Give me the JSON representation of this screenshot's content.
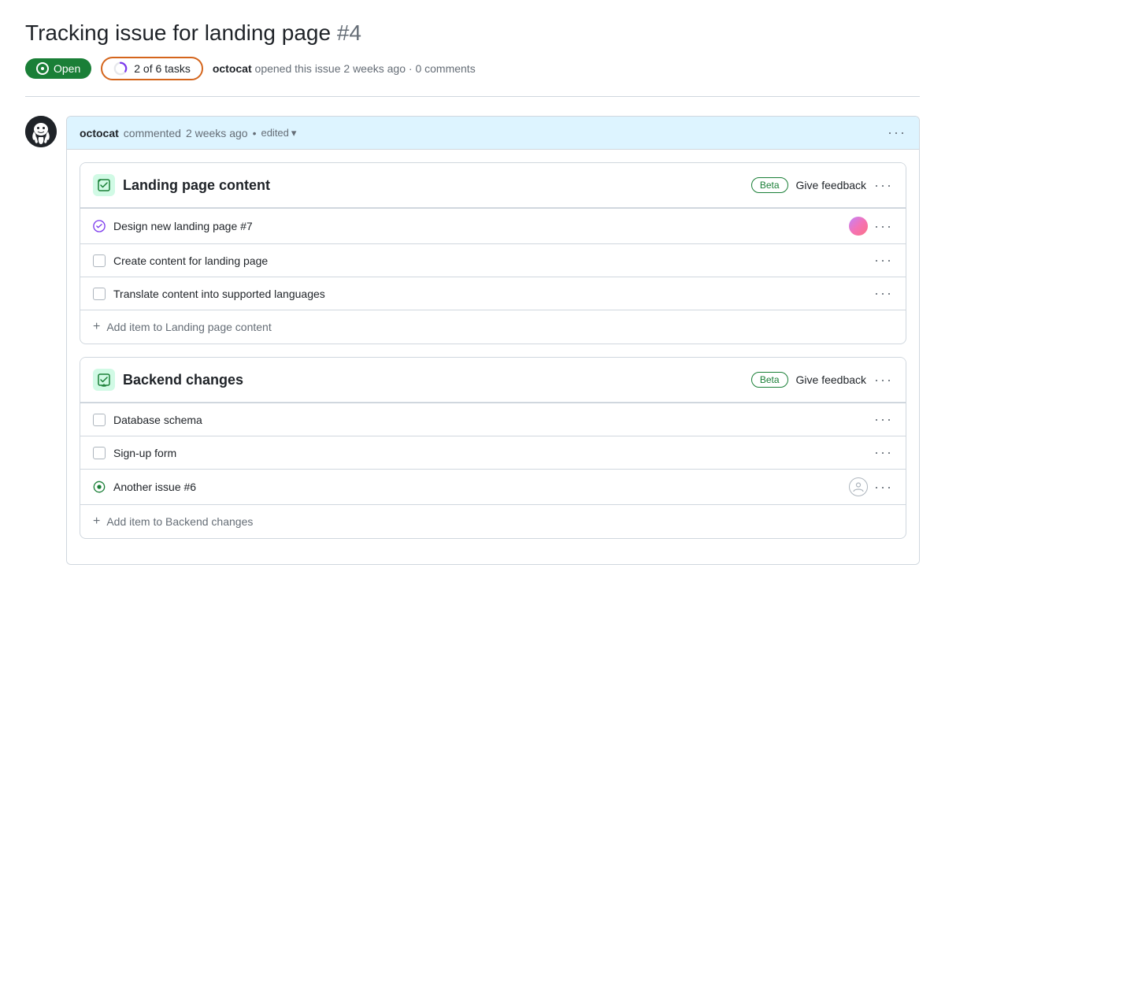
{
  "page": {
    "title": "Tracking issue for landing page",
    "issue_number": "#4",
    "open_label": "Open",
    "tasks_label": "2 of 6 tasks",
    "meta": {
      "author": "octocat",
      "action": "opened this issue",
      "time": "2 weeks ago",
      "separator": "·",
      "comments": "0 comments"
    }
  },
  "comment": {
    "author": "octocat",
    "action": "commented",
    "time": "2 weeks ago",
    "edited": "edited",
    "more_options": "···"
  },
  "tasklists": [
    {
      "id": "landing-page-content",
      "title": "Landing page content",
      "beta_label": "Beta",
      "feedback_label": "Give feedback",
      "tasks": [
        {
          "id": "task-design-landing",
          "label": "Design new landing page #7",
          "checked": true,
          "check_type": "purple",
          "has_assignee": true
        },
        {
          "id": "task-create-content",
          "label": "Create content for landing page",
          "checked": false,
          "check_type": "none",
          "has_assignee": false
        },
        {
          "id": "task-translate",
          "label": "Translate content into supported languages",
          "checked": false,
          "check_type": "none",
          "has_assignee": false
        }
      ],
      "add_item_label": "Add item to Landing page content"
    },
    {
      "id": "backend-changes",
      "title": "Backend changes",
      "beta_label": "Beta",
      "feedback_label": "Give feedback",
      "tasks": [
        {
          "id": "task-db-schema",
          "label": "Database schema",
          "checked": false,
          "check_type": "none",
          "has_assignee": false
        },
        {
          "id": "task-signup-form",
          "label": "Sign-up form",
          "checked": false,
          "check_type": "none",
          "has_assignee": false
        },
        {
          "id": "task-another-issue",
          "label": "Another issue #6",
          "checked": true,
          "check_type": "green",
          "has_assignee": true,
          "assignee_placeholder": true
        }
      ],
      "add_item_label": "Add item to Backend changes"
    }
  ],
  "icons": {
    "open_dot": "circle",
    "progress_ring": "ring",
    "three_dots": "···",
    "plus": "+",
    "check_purple": "✓",
    "check_green": "circle-dot"
  },
  "colors": {
    "open_green": "#1a7f37",
    "tasks_border": "#d4651c",
    "purple_check": "#7c3aed",
    "green_check": "#1a7f37",
    "beta_green": "#1a7f37",
    "header_blue": "#ddf4ff"
  }
}
